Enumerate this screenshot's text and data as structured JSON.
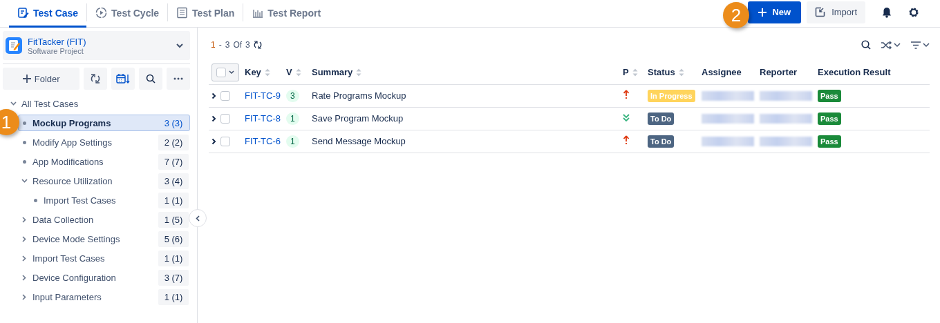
{
  "nav": {
    "tabs": [
      {
        "label": "Test Case",
        "selected": true
      },
      {
        "label": "Test Cycle",
        "selected": false
      },
      {
        "label": "Test Plan",
        "selected": false
      },
      {
        "label": "Test Report",
        "selected": false
      }
    ],
    "new_button": "New",
    "import_button": "Import"
  },
  "project": {
    "name": "FitTacker (FIT)",
    "type": "Software Project"
  },
  "sidebar": {
    "folder_button": "Folder",
    "tree": [
      {
        "label": "All Test Cases",
        "expanded": true,
        "children": [
          {
            "label": "Mockup Programs",
            "count": "3 (3)",
            "selected": true
          },
          {
            "label": "Modify App Settings",
            "count": "2 (2)",
            "selected": false
          },
          {
            "label": "App Modifications",
            "count": "7 (7)",
            "selected": false
          },
          {
            "label": "Resource Utilization",
            "count": "3 (4)",
            "selected": false,
            "expanded": true,
            "children": [
              {
                "label": "Import Test Cases",
                "count": "1 (1)",
                "selected": false
              }
            ]
          },
          {
            "label": "Data Collection",
            "count": "1 (5)",
            "selected": false,
            "expanded": false
          },
          {
            "label": "Device Mode Settings",
            "count": "5 (6)",
            "selected": false,
            "expanded": false
          },
          {
            "label": "Import Test Cases",
            "count": "1 (1)",
            "selected": false,
            "expanded": false
          },
          {
            "label": "Device Configuration",
            "count": "3 (7)",
            "selected": false,
            "expanded": false
          },
          {
            "label": "Input Parameters",
            "count": "1 (1)",
            "selected": false,
            "expanded": false
          }
        ]
      }
    ]
  },
  "pager": {
    "range_start": "1",
    "dash": "-",
    "range_end": "3",
    "of": "Of",
    "total": "3"
  },
  "table": {
    "columns": [
      {
        "label": "Key",
        "sortable": true
      },
      {
        "label": "V",
        "sortable": true
      },
      {
        "label": "Summary",
        "sortable": true
      },
      {
        "label": "P",
        "sortable": true
      },
      {
        "label": "Status",
        "sortable": true
      },
      {
        "label": "Assignee",
        "sortable": false
      },
      {
        "label": "Reporter",
        "sortable": false
      },
      {
        "label": "Execution Result",
        "sortable": false
      }
    ],
    "rows": [
      {
        "key": "FIT-TC-9",
        "version": "3",
        "summary": "Rate Programs Mockup",
        "priority": {
          "kind": "high"
        },
        "status": {
          "label": "In Progress",
          "color": "#ffd45c"
        },
        "assignee_blurred": true,
        "reporter_blurred": true,
        "result": {
          "label": "Pass",
          "color": "#1a8a3a"
        },
        "checked": false
      },
      {
        "key": "FIT-TC-8",
        "version": "1",
        "summary": "Save Program Mockup",
        "priority": {
          "kind": "low"
        },
        "status": {
          "label": "To Do",
          "color": "#4d6582"
        },
        "assignee_blurred": true,
        "reporter_blurred": true,
        "result": {
          "label": "Pass",
          "color": "#1a8a3a"
        },
        "checked": false
      },
      {
        "key": "FIT-TC-6",
        "version": "1",
        "summary": "Send Message Mockup",
        "priority": {
          "kind": "high"
        },
        "status": {
          "label": "To Do",
          "color": "#4d6582"
        },
        "assignee_blurred": true,
        "reporter_blurred": true,
        "result": {
          "label": "Pass",
          "color": "#1a8a3a"
        },
        "checked": false
      }
    ]
  },
  "callouts": [
    {
      "label": "1"
    },
    {
      "label": "2"
    }
  ]
}
